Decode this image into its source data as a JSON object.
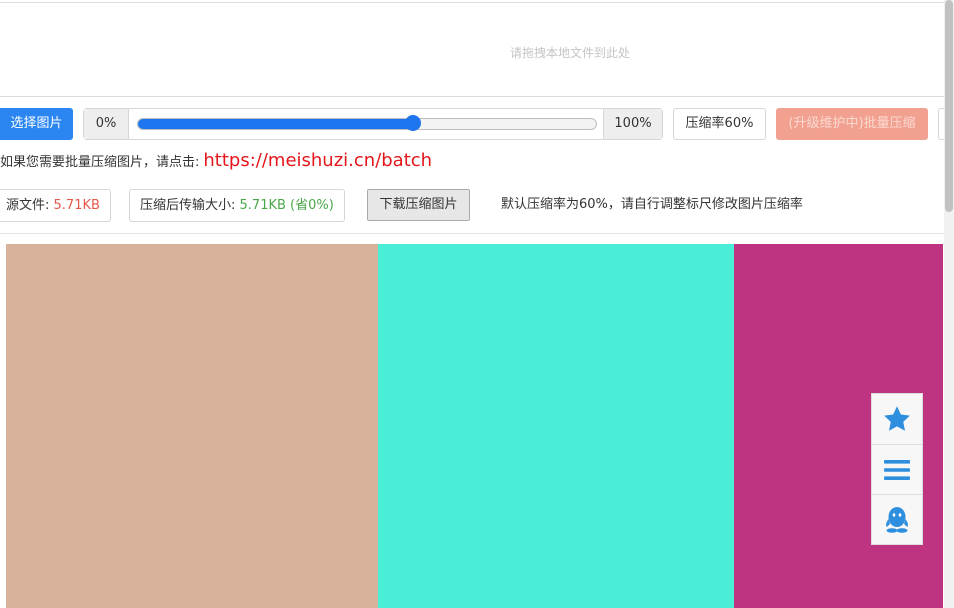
{
  "dropzone": {
    "text": "请拖拽本地文件到此处"
  },
  "toolbar": {
    "choose_label": "选择图片",
    "slider": {
      "min_label": "0%",
      "max_label": "100%",
      "value_percent": 60
    },
    "rate_label": "压缩率60%",
    "batch_button_label": "(升级维护中)批量压缩"
  },
  "batch_info": {
    "prefix": "如果您需要批量压缩图片，请点击:",
    "link_text": "https://meishuzi.cn/batch"
  },
  "stats": {
    "source_label": "源文件:",
    "source_value": "5.71KB",
    "compressed_label": "压缩后传输大小:",
    "compressed_value": "5.71KB (省0%)",
    "download_label": "下载压缩图片",
    "default_note": "默认压缩率为60%，请自行调整标尺修改图片压缩率"
  },
  "image_preview": {
    "stripes": [
      {
        "color": "#d8b29a"
      },
      {
        "color": "#4aeed6"
      },
      {
        "color": "#bf3480"
      }
    ]
  },
  "float_bar": {
    "icons": [
      "star-icon",
      "menu-icon",
      "qq-icon"
    ],
    "accent": "#2e8fde"
  }
}
